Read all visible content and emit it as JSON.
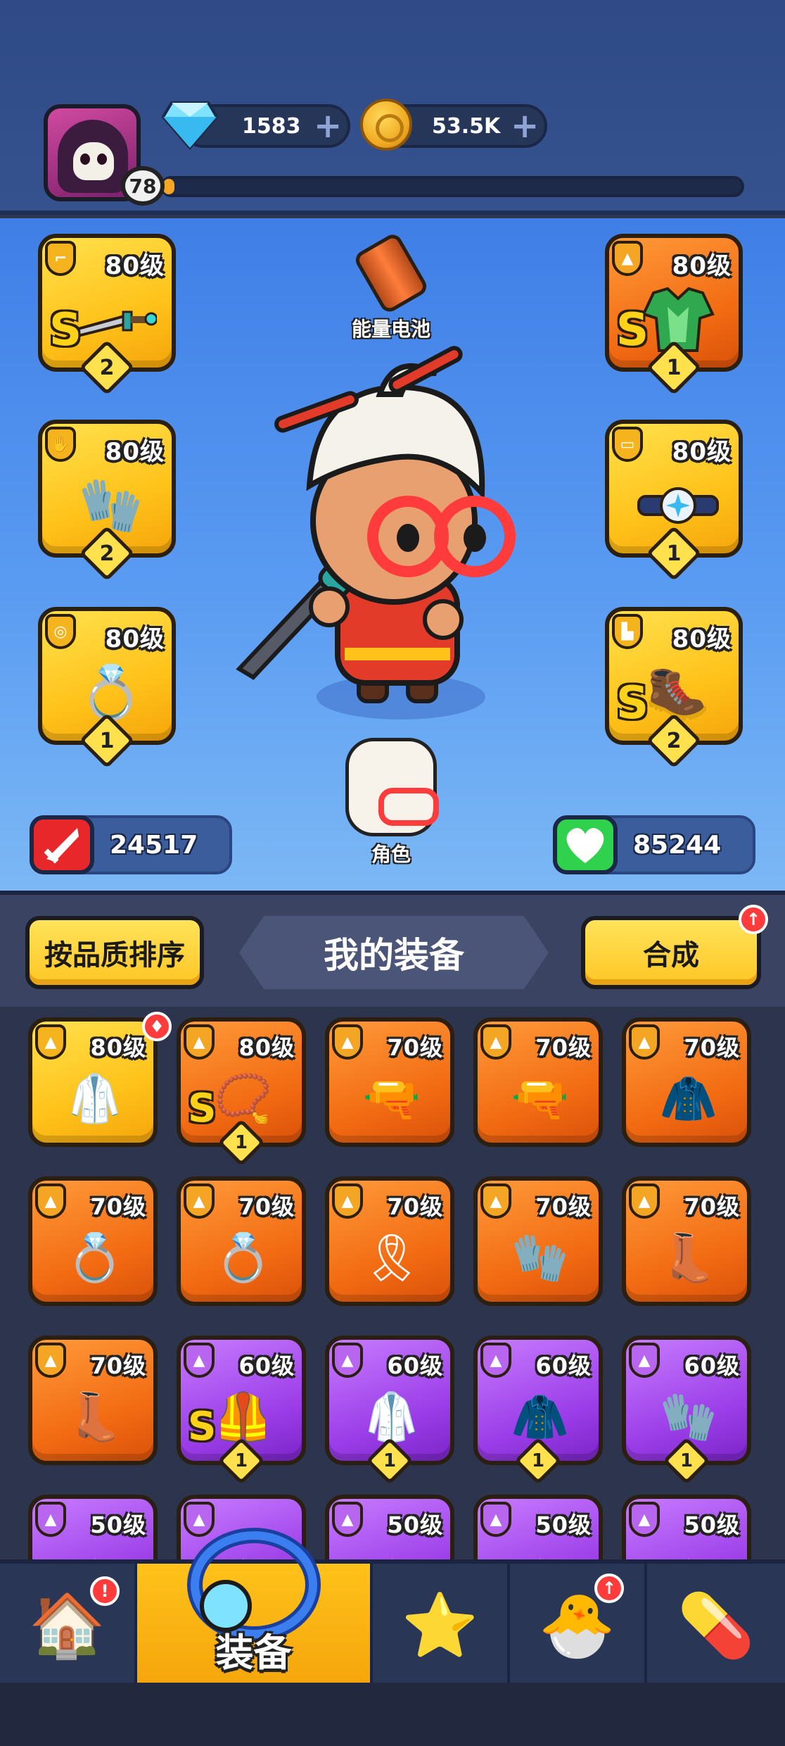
{
  "player": {
    "level": "78",
    "xp_progress": 0.02,
    "gems": "1583",
    "coins": "53.5K",
    "plus_symbol": "+"
  },
  "hero": {
    "energy_label": "能量电池",
    "role_label": "角色",
    "attack": "24517",
    "health": "85244"
  },
  "equipped": [
    {
      "type": "weapon",
      "level": "80级",
      "grade": "S",
      "stars": "2",
      "icon": "sword-icon"
    },
    {
      "type": "armor",
      "level": "80级",
      "grade": "S",
      "stars": "1",
      "icon": "armor-icon"
    },
    {
      "type": "gloves",
      "level": "80级",
      "grade": "",
      "stars": "2",
      "icon": "glove-icon"
    },
    {
      "type": "belt",
      "level": "80级",
      "grade": "",
      "stars": "1",
      "icon": "belt-icon"
    },
    {
      "type": "ring",
      "level": "80级",
      "grade": "",
      "stars": "1",
      "icon": "ring-icon"
    },
    {
      "type": "boots",
      "level": "80级",
      "grade": "S",
      "stars": "2",
      "icon": "boots-icon"
    }
  ],
  "inventory": {
    "sort_label": "按品质排序",
    "title": "我的装备",
    "merge_label": "合成",
    "items": [
      {
        "level": "80级",
        "rarity": "gold",
        "grade": "",
        "stars": "",
        "icon": "robe-icon",
        "badge": "shirt"
      },
      {
        "level": "80级",
        "rarity": "orange",
        "grade": "S",
        "stars": "1",
        "icon": "necklace-icon"
      },
      {
        "level": "70级",
        "rarity": "orange",
        "grade": "",
        "stars": "",
        "icon": "pistol-icon"
      },
      {
        "level": "70级",
        "rarity": "orange",
        "grade": "",
        "stars": "",
        "icon": "shotgun-icon"
      },
      {
        "level": "70级",
        "rarity": "orange",
        "grade": "",
        "stars": "",
        "icon": "coat-icon"
      },
      {
        "level": "70级",
        "rarity": "orange",
        "grade": "",
        "stars": "",
        "icon": "ring-icon"
      },
      {
        "level": "70级",
        "rarity": "orange",
        "grade": "",
        "stars": "",
        "icon": "ring-icon"
      },
      {
        "level": "70级",
        "rarity": "orange",
        "grade": "",
        "stars": "",
        "icon": "belt-icon"
      },
      {
        "level": "70级",
        "rarity": "orange",
        "grade": "",
        "stars": "",
        "icon": "glove-icon"
      },
      {
        "level": "70级",
        "rarity": "orange",
        "grade": "",
        "stars": "",
        "icon": "boots-icon"
      },
      {
        "level": "70级",
        "rarity": "orange",
        "grade": "",
        "stars": "",
        "icon": "boots-icon"
      },
      {
        "level": "60级",
        "rarity": "purple",
        "grade": "S",
        "stars": "1",
        "icon": "armor-icon"
      },
      {
        "level": "60级",
        "rarity": "purple",
        "grade": "",
        "stars": "1",
        "icon": "robe-icon"
      },
      {
        "level": "60级",
        "rarity": "purple",
        "grade": "",
        "stars": "1",
        "icon": "coat-icon"
      },
      {
        "level": "60级",
        "rarity": "purple",
        "grade": "",
        "stars": "1",
        "icon": "glove-icon"
      },
      {
        "level": "50级",
        "rarity": "purple",
        "grade": "",
        "stars": "",
        "icon": "item-icon"
      },
      {
        "level": "",
        "rarity": "purple",
        "grade": "",
        "stars": "",
        "icon": "item-icon"
      },
      {
        "level": "50级",
        "rarity": "purple",
        "grade": "",
        "stars": "",
        "icon": "item-icon"
      },
      {
        "level": "50级",
        "rarity": "purple",
        "grade": "",
        "stars": "",
        "icon": "item-icon"
      },
      {
        "level": "50级",
        "rarity": "purple",
        "grade": "",
        "stars": "",
        "icon": "item-icon"
      }
    ]
  },
  "nav": {
    "active_label": "装备",
    "items": [
      "shop",
      "equipment",
      "talent",
      "pet",
      "skill"
    ]
  },
  "colors": {
    "gold": "#ffc21a",
    "orange": "#f26a12",
    "purple": "#9b3de8",
    "attack": "#e8272b",
    "health": "#2fd14d"
  }
}
